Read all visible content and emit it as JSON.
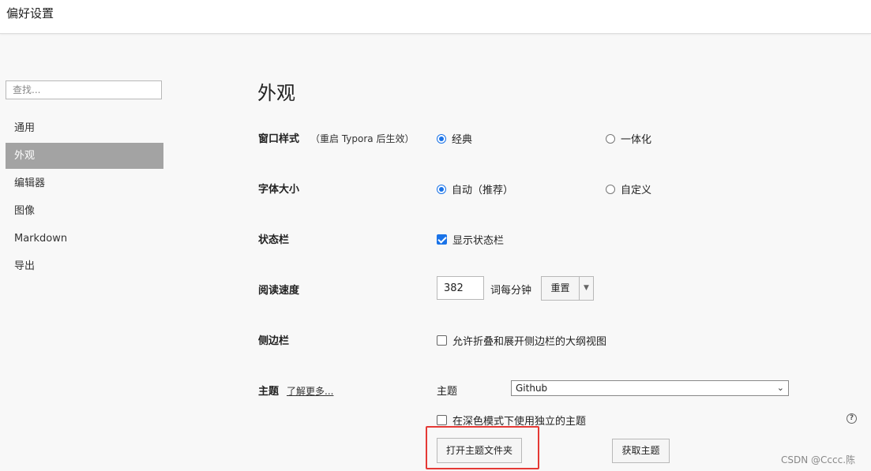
{
  "window": {
    "title": "偏好设置"
  },
  "sidebar": {
    "search_placeholder": "查找...",
    "items": [
      {
        "label": "通用",
        "active": false
      },
      {
        "label": "外观",
        "active": true
      },
      {
        "label": "编辑器",
        "active": false
      },
      {
        "label": "图像",
        "active": false
      },
      {
        "label": "Markdown",
        "active": false
      },
      {
        "label": "导出",
        "active": false
      }
    ]
  },
  "main": {
    "title": "外观",
    "window_style": {
      "label": "窗口样式",
      "note": "（重启 Typora 后生效）",
      "option_classic": "经典",
      "option_unibody": "一体化",
      "selected": "经典"
    },
    "font_size": {
      "label": "字体大小",
      "option_auto": "自动（推荐）",
      "option_custom": "自定义",
      "selected": "自动（推荐）"
    },
    "status_bar": {
      "label": "状态栏",
      "checkbox_label": "显示状态栏",
      "checked": true
    },
    "reading_speed": {
      "label": "阅读速度",
      "value": "382",
      "unit": "词每分钟",
      "reset_label": "重置",
      "dropdown_icon": "▼"
    },
    "sidebar_setting": {
      "label": "侧边栏",
      "checkbox_label": "允许折叠和展开侧边栏的大纲视图",
      "checked": false
    },
    "theme": {
      "label": "主题",
      "learn_more": "了解更多...",
      "select_label": "主题",
      "selected_theme": "Github",
      "dark_mode_label": "在深色模式下使用独立的主题",
      "dark_mode_checked": false,
      "open_folder_label": "打开主题文件夹",
      "get_themes_label": "获取主题",
      "help_icon": "?"
    }
  },
  "highlight_color": "#e53935",
  "accent_color": "#1a73e8",
  "watermark": "CSDN @Cccc.陈"
}
